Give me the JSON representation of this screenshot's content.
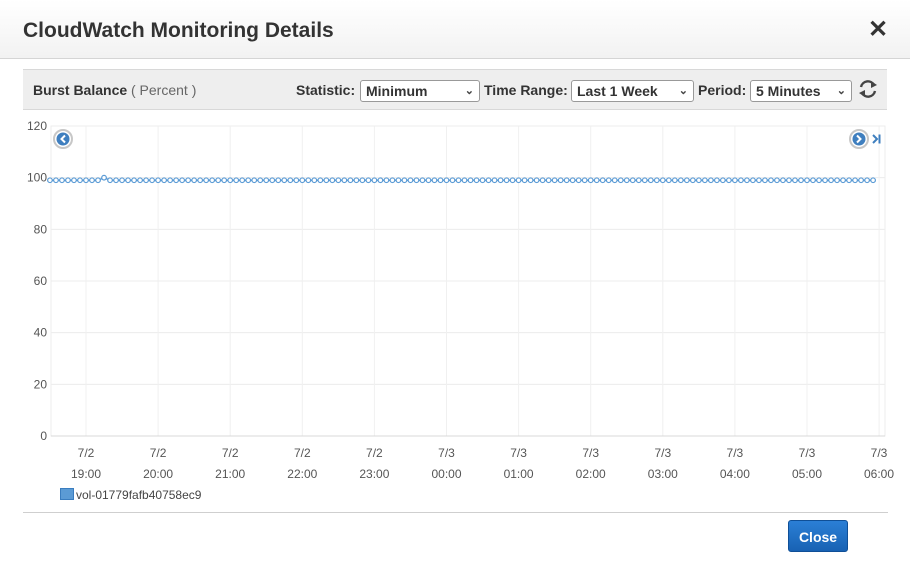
{
  "dialog": {
    "title": "CloudWatch Monitoring Details",
    "close_icon": "close-icon",
    "close_glyph": "✕",
    "close_button_label": "Close"
  },
  "toolbar": {
    "metric_name": "Burst Balance",
    "metric_unit": "( Percent )",
    "statistic_label": "Statistic:",
    "statistic_value": "Minimum",
    "time_range_label": "Time Range:",
    "time_range_value": "Last 1 Week",
    "period_label": "Period:",
    "period_value": "5 Minutes",
    "refresh_icon": "refresh-icon"
  },
  "nav": {
    "prev_icon": "chevron-left-icon",
    "next_icon": "chevron-right-icon",
    "last_icon": "skip-to-end-icon"
  },
  "colors": {
    "series": "#5b9bd5",
    "accent_button": "#1f6fc5"
  },
  "chart_data": {
    "type": "line",
    "title": "",
    "xlabel": "",
    "ylabel": "",
    "ylim": [
      0,
      120
    ],
    "yticks": [
      0,
      20,
      40,
      60,
      80,
      100,
      120
    ],
    "grid": true,
    "legend": "bottom-left",
    "x_tick_labels": [
      {
        "date": "7/2",
        "time": "19:00"
      },
      {
        "date": "7/2",
        "time": "20:00"
      },
      {
        "date": "7/2",
        "time": "21:00"
      },
      {
        "date": "7/2",
        "time": "22:00"
      },
      {
        "date": "7/2",
        "time": "23:00"
      },
      {
        "date": "7/3",
        "time": "00:00"
      },
      {
        "date": "7/3",
        "time": "01:00"
      },
      {
        "date": "7/3",
        "time": "02:00"
      },
      {
        "date": "7/3",
        "time": "03:00"
      },
      {
        "date": "7/3",
        "time": "04:00"
      },
      {
        "date": "7/3",
        "time": "05:00"
      },
      {
        "date": "7/3",
        "time": "06:00"
      }
    ],
    "x_range": [
      "7/2 18:30",
      "7/3 06:00"
    ],
    "series": [
      {
        "name": "vol-01779fafb40758ec9",
        "interval": "5 Minutes",
        "start": "7/2 18:30",
        "end": "7/3 05:55",
        "values": [
          99,
          99,
          99,
          99,
          99,
          99,
          99,
          99,
          99,
          100,
          99,
          99,
          99,
          99,
          99,
          99,
          99,
          99,
          99,
          99,
          99,
          99,
          99,
          99,
          99,
          99,
          99,
          99,
          99,
          99,
          99,
          99,
          99,
          99,
          99,
          99,
          99,
          99,
          99,
          99,
          99,
          99,
          99,
          99,
          99,
          99,
          99,
          99,
          99,
          99,
          99,
          99,
          99,
          99,
          99,
          99,
          99,
          99,
          99,
          99,
          99,
          99,
          99,
          99,
          99,
          99,
          99,
          99,
          99,
          99,
          99,
          99,
          99,
          99,
          99,
          99,
          99,
          99,
          99,
          99,
          99,
          99,
          99,
          99,
          99,
          99,
          99,
          99,
          99,
          99,
          99,
          99,
          99,
          99,
          99,
          99,
          99,
          99,
          99,
          99,
          99,
          99,
          99,
          99,
          99,
          99,
          99,
          99,
          99,
          99,
          99,
          99,
          99,
          99,
          99,
          99,
          99,
          99,
          99,
          99,
          99,
          99,
          99,
          99,
          99,
          99,
          99,
          99,
          99,
          99,
          99,
          99,
          99,
          99,
          99,
          99,
          99,
          99
        ]
      }
    ]
  }
}
